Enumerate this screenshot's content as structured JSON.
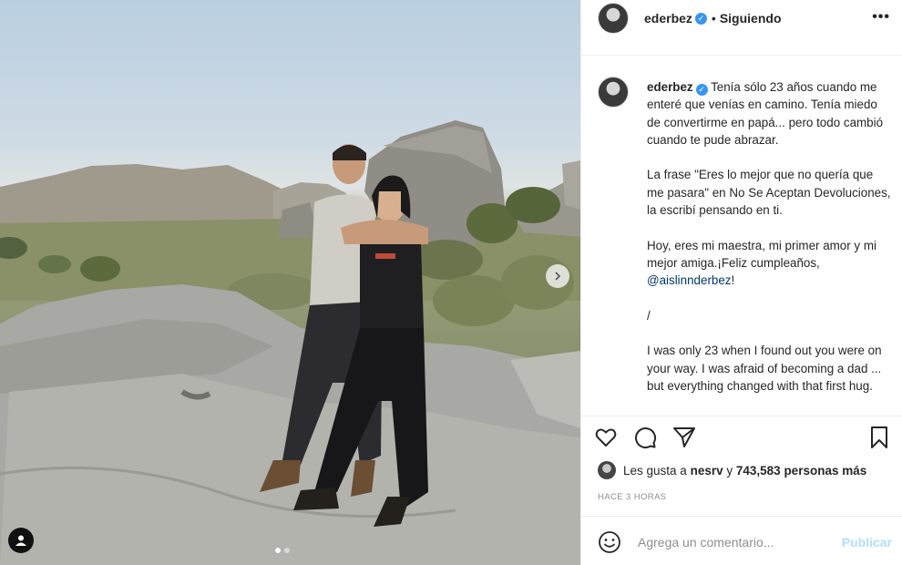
{
  "post": {
    "username": "ederbez",
    "header": {
      "separator": "•",
      "following_label": "Siguiendo",
      "more_label": "•••"
    },
    "caption": {
      "p1": "Tenía sólo 23 años cuando me enteré que venías en camino. Tenía miedo de convertirme en papá... pero todo cambió cuando te pude abrazar.",
      "p2": "La frase \"Eres lo mejor que no quería que me pasara\" en No Se Aceptan Devoluciones, la escribí pensando en ti.",
      "p3_a": "Hoy, eres mi maestra, mi primer amor y mi mejor amiga.¡Feliz cumpleaños,",
      "mention": "@aislinnderbez",
      "p3_b": "!",
      "p4": "/",
      "p5": "I was only 23 when I found out you were on your way. I was afraid of becoming a dad ... but everything changed with that first hug."
    },
    "likes": {
      "prefix": "Les gusta a",
      "first_user": "nesrv",
      "connector": "y",
      "count": "743,583 personas más"
    },
    "timestamp": "Hace 3 horas",
    "comment": {
      "placeholder": "Agrega un comentario...",
      "publish_label": "Publicar"
    },
    "carousel": {
      "total": 2,
      "current": 1
    },
    "colors": {
      "link": "#00376b",
      "verified": "#3897f0",
      "publish_disabled": "#b2dffc",
      "muted": "#8e8e8e"
    },
    "icons": [
      "verified-badge-icon",
      "more-options-icon",
      "heart-icon",
      "comment-icon",
      "share-icon",
      "bookmark-icon",
      "emoji-icon",
      "next-arrow-icon",
      "user-tag-icon"
    ]
  }
}
